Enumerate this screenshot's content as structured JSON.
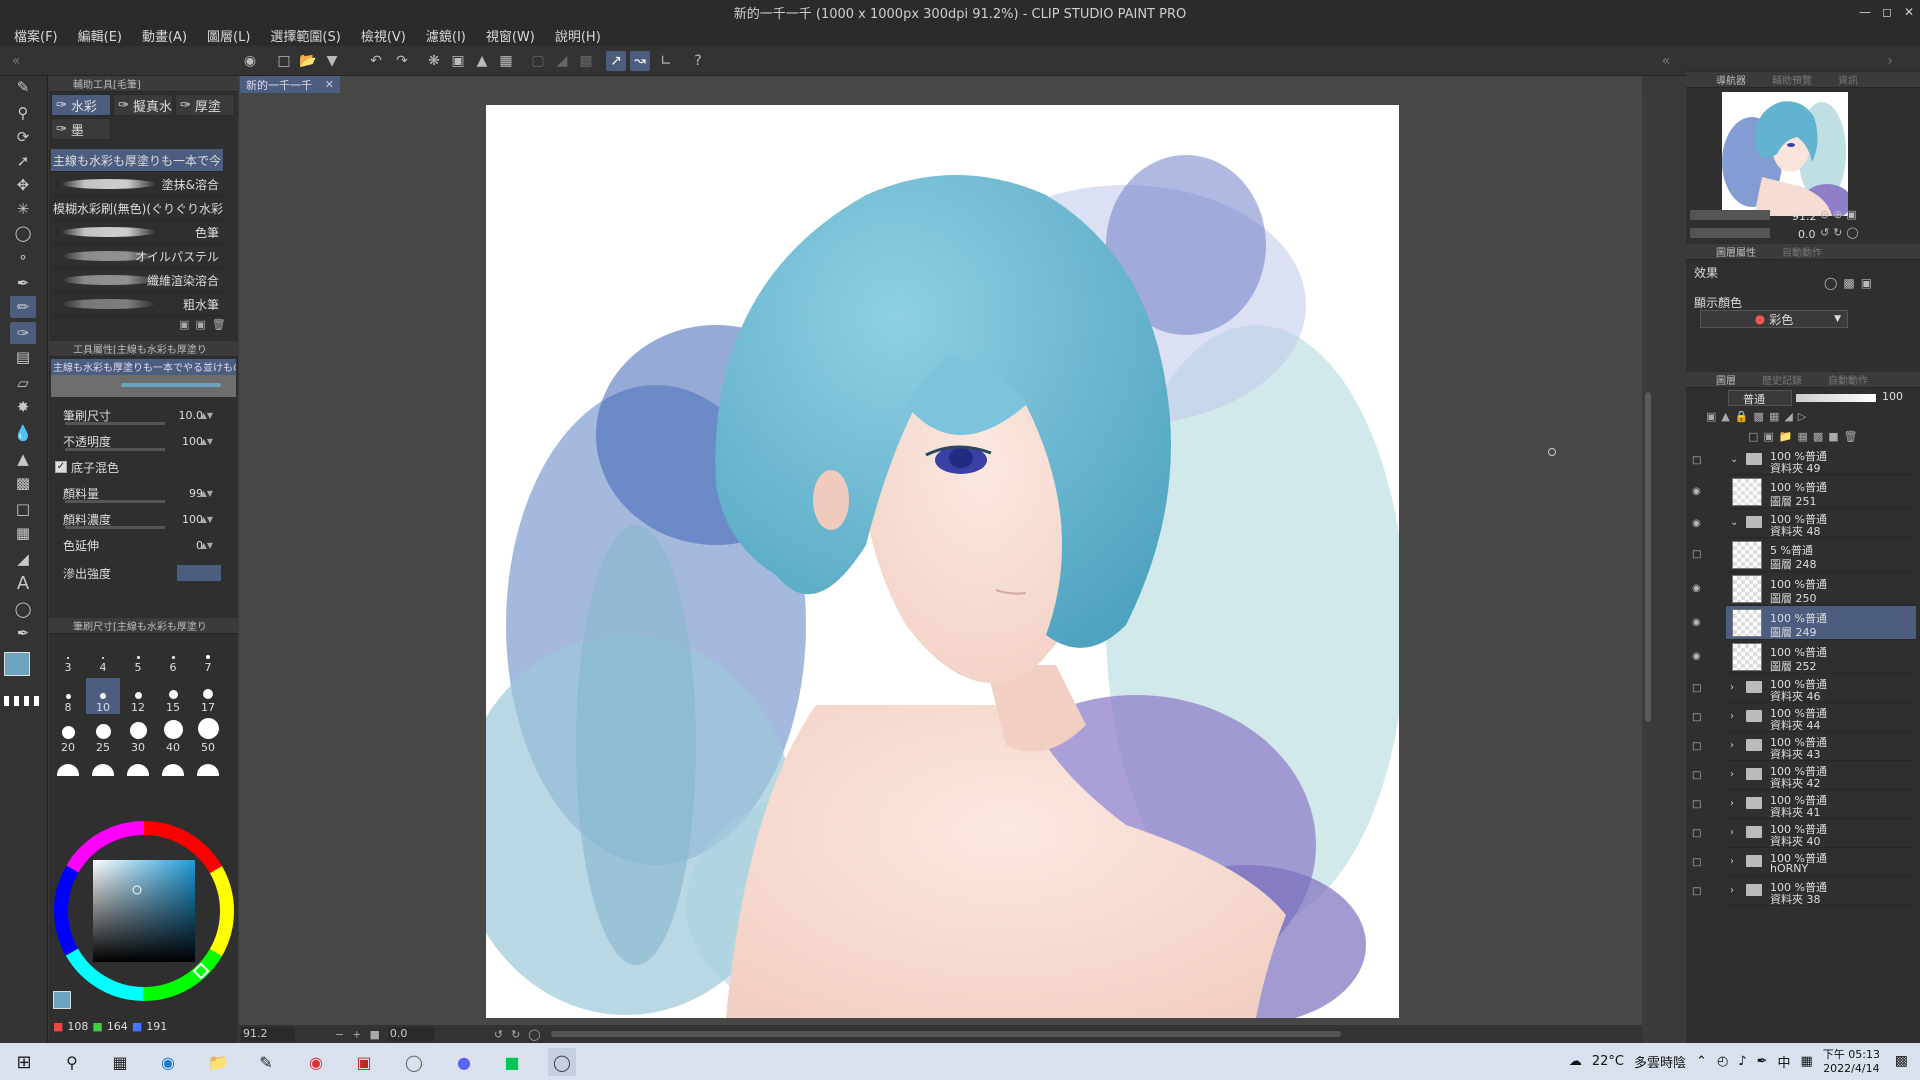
{
  "window": {
    "title": "新的一千一千 (1000 x 1000px 300dpi 91.2%)  - CLIP STUDIO PAINT PRO"
  },
  "menus": [
    "檔案(F)",
    "編輯(E)",
    "動畫(A)",
    "圖層(L)",
    "選擇範圍(S)",
    "檢視(V)",
    "濾鏡(I)",
    "視窗(W)",
    "說明(H)"
  ],
  "sub_tool_panel": {
    "title": "輔助工具[毛筆]",
    "tabs": [
      "水彩",
      "擬真水",
      "厚塗",
      "墨"
    ],
    "brushes": [
      "主線も水彩も厚塗りも一本で今",
      "塗抹&溶合",
      "模糊水彩刷(無色)(ぐりぐり水彩",
      "色筆",
      "オイルパステル",
      "纖維渲染溶合",
      "粗水筆"
    ]
  },
  "tool_property": {
    "title": "工具屬性[主線も水彩も厚塗り",
    "preview_name": "主線も水彩も厚塗りも一本でやる並けものブ",
    "brush_size_label": "筆刷尺寸",
    "brush_size_value": "10.0",
    "opacity_label": "不透明度",
    "opacity_value": "100",
    "blend_label": "底子混色",
    "paint_amount_label": "顏料量",
    "paint_amount_value": "99",
    "paint_density_label": "顏料濃度",
    "paint_density_value": "100",
    "color_stretch_label": "色延伸",
    "color_stretch_value": "0",
    "bleed_label": "滲出強度"
  },
  "brush_size_panel": {
    "title": "筆刷尺寸[主線も水彩も厚塗り",
    "sizes": [
      "3",
      "4",
      "5",
      "6",
      "7",
      "8",
      "10",
      "12",
      "15",
      "17",
      "20",
      "25",
      "30",
      "40",
      "50"
    ],
    "selected": "10"
  },
  "color": {
    "r": "108",
    "g": "164",
    "b": "191",
    "current_hex": "#6ca4bf"
  },
  "canvas": {
    "doc_tab": "新的一千一千",
    "zoom": "91.2",
    "rotation": "0.0"
  },
  "navigator": {
    "tabs": [
      "導航器",
      "輔助預覽",
      "資訊"
    ],
    "zoom": "91.2",
    "rotation": "0.0"
  },
  "layer_property": {
    "tabs": [
      "圖層屬性",
      "自動動作"
    ],
    "effect_label": "效果",
    "display_color_label": "顯示顏色",
    "display_color_value": "彩色"
  },
  "layers_panel": {
    "tabs": [
      "圖層",
      "歷史記錄",
      "自動動作"
    ],
    "blend_mode": "普通",
    "opacity": "100",
    "rows": [
      {
        "kind": "folder",
        "open": true,
        "line1": "100 %普通",
        "line2": "資料夾 49"
      },
      {
        "kind": "layer",
        "line1": "100 %普通",
        "line2": "圖層 251"
      },
      {
        "kind": "folder",
        "open": true,
        "line1": "100 %普通",
        "line2": "資料夾 48"
      },
      {
        "kind": "layer",
        "line1": "5 %普通",
        "line2": "圖層 248"
      },
      {
        "kind": "layer",
        "line1": "100 %普通",
        "line2": "圖層 250"
      },
      {
        "kind": "layer",
        "active": true,
        "line1": "100 %普通",
        "line2": "圖層 249"
      },
      {
        "kind": "layer",
        "line1": "100 %普通",
        "line2": "圖層 252"
      },
      {
        "kind": "folder",
        "line1": "100 %普通",
        "line2": "資料夾 46"
      },
      {
        "kind": "folder",
        "line1": "100 %普通",
        "line2": "資料夾 44"
      },
      {
        "kind": "folder",
        "line1": "100 %普通",
        "line2": "資料夾 43"
      },
      {
        "kind": "folder",
        "line1": "100 %普通",
        "line2": "資料夾 42"
      },
      {
        "kind": "folder",
        "line1": "100 %普通",
        "line2": "資料夾 41"
      },
      {
        "kind": "folder",
        "line1": "100 %普通",
        "line2": "資料夾 40"
      },
      {
        "kind": "folder",
        "line1": "100 %普通",
        "line2": "hORNY"
      },
      {
        "kind": "folder",
        "line1": "100 %普通",
        "line2": "資料夾 38"
      }
    ]
  },
  "taskbar": {
    "weather_temp": "22°C",
    "weather_text": "多雲時陰",
    "ime": "中",
    "time": "下午 05:13",
    "date": "2022/4/14"
  },
  "colors": {
    "accent": "#4d5d80",
    "panel": "#2f2f2f",
    "canvas_bg": "#474747"
  }
}
